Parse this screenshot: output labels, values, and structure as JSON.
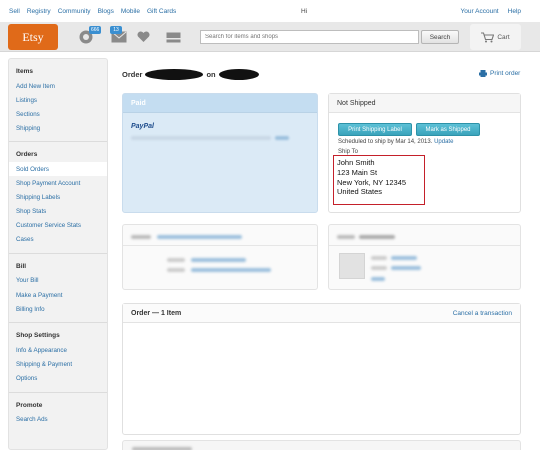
{
  "topnav": {
    "links": [
      "Sell",
      "Registry",
      "Community",
      "Blogs",
      "Mobile",
      "Gift Cards"
    ],
    "greeting": "Hi",
    "right_links": [
      "Your Account",
      "Help"
    ]
  },
  "header": {
    "logo": "Etsy",
    "activity_badge": "666",
    "messages_badge": "13",
    "search_placeholder": "Search for items and shops",
    "search_button": "Search",
    "cart_label": "Cart"
  },
  "sidebar": {
    "sections": [
      {
        "title": "Items",
        "items": [
          "Add New Item",
          "Listings",
          "Sections",
          "Shipping"
        ]
      },
      {
        "title": "Orders",
        "items": [
          "Sold Orders",
          "Shop Payment Account",
          "Shipping Labels",
          "Shop Stats",
          "Customer Service Stats",
          "Cases"
        ]
      },
      {
        "title": "Bill",
        "items": [
          "Your Bill",
          "Make a Payment",
          "Billing Info"
        ]
      },
      {
        "title": "Shop Settings",
        "items": [
          "Info & Appearance",
          "Shipping & Payment",
          "Options"
        ]
      },
      {
        "title": "Promote",
        "items": [
          "Search Ads"
        ]
      }
    ],
    "active_item": "Sold Orders"
  },
  "main": {
    "order_prefix": "Order",
    "order_on": "on",
    "print_order": "Print order",
    "paid_panel": {
      "title": "Paid",
      "payment_method": "PayPal"
    },
    "ship_panel": {
      "title": "Not Shipped",
      "print_label_button": "Print Shipping Label",
      "mark_shipped_button": "Mark as Shipped",
      "scheduled_text": "Scheduled to ship by Mar 14, 2013.",
      "update_link": "Update",
      "ship_to_label": "Ship To",
      "address": [
        "John Smith",
        "123 Main St",
        "New York, NY 12345",
        "United States"
      ]
    },
    "items_panel": {
      "title": "Order — 1 Item",
      "cancel_link": "Cancel a transaction"
    }
  },
  "colors": {
    "brand": "#e06a19",
    "link": "#2b6fa5",
    "button": "#3aa3bb",
    "highlight_border": "#c4202a"
  }
}
